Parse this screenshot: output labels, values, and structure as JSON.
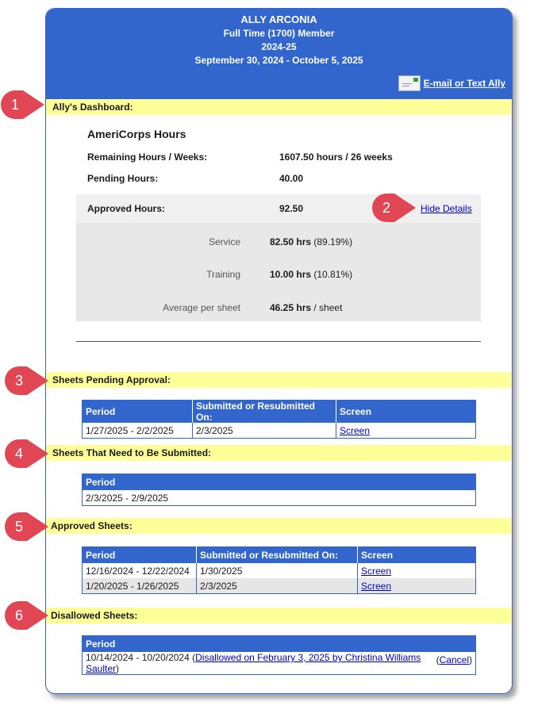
{
  "header": {
    "name": "ALLY ARCONIA",
    "position": "Full Time (1700) Member",
    "year": "2024-25",
    "date_range": "September 30, 2024 - October 5, 2025",
    "email_link": "E-mail or Text Ally",
    "email_icon": "envelope-icon"
  },
  "markers": [
    "1",
    "2",
    "3",
    "4",
    "5",
    "6"
  ],
  "dashboard": {
    "section_title": "Ally's Dashboard:",
    "title": "AmeriCorps Hours",
    "remaining_label": "Remaining Hours / Weeks:",
    "remaining_value": "1607.50 hours / 26 weeks",
    "pending_label": "Pending Hours:",
    "pending_value": "40.00",
    "approved_label": "Approved Hours:",
    "approved_value": "92.50",
    "hide_details": "Hide Details",
    "details": [
      {
        "label": "Service",
        "value_bold": "82.50 hrs",
        "value_rest": " (89.19%)"
      },
      {
        "label": "Training",
        "value_bold": "10.00 hrs",
        "value_rest": " (10.81%)"
      },
      {
        "label": "Average per sheet",
        "value_bold": "46.25 hrs",
        "value_rest": " / sheet"
      }
    ]
  },
  "pending": {
    "section_title": "Sheets Pending Approval:",
    "columns": [
      "Period",
      "Submitted or Resubmitted On:",
      "Screen"
    ],
    "rows": [
      {
        "period": "1/27/2025 - 2/2/2025",
        "submitted": "2/3/2025",
        "screen": "Screen"
      }
    ]
  },
  "need_submit": {
    "section_title": "Sheets That Need to Be Submitted:",
    "columns": [
      "Period"
    ],
    "rows": [
      {
        "period": "2/3/2025 - 2/9/2025"
      }
    ]
  },
  "approved": {
    "section_title": "Approved Sheets:",
    "columns": [
      "Period",
      "Submitted or Resubmitted On:",
      "Screen"
    ],
    "rows": [
      {
        "period": "12/16/2024 - 12/22/2024",
        "submitted": "1/30/2025",
        "screen": "Screen"
      },
      {
        "period": "1/20/2025 - 1/26/2025",
        "submitted": "2/3/2025",
        "screen": "Screen"
      }
    ]
  },
  "disallowed": {
    "section_title": "Disallowed Sheets:",
    "columns": [
      "Period"
    ],
    "row": {
      "period": "10/14/2024 - 10/20/2024",
      "open_paren": " (",
      "link_a": "Disallowed on February 3, 2025 by Christina Williams",
      "link_b": "Saulter",
      "close_paren": ")",
      "cancel_open": "(",
      "cancel": "Cancel",
      "cancel_close": ")"
    }
  }
}
